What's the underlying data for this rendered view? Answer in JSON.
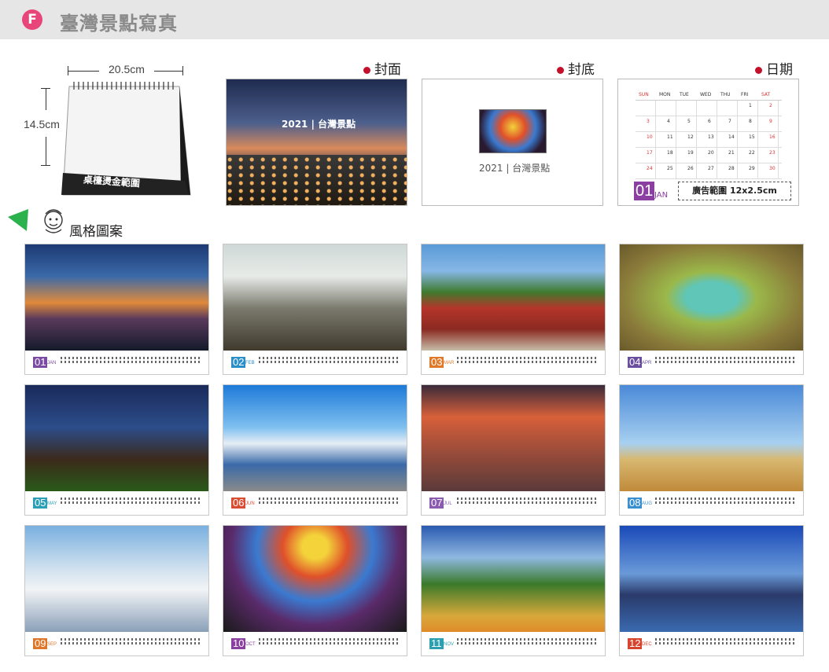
{
  "header": {
    "badge": "F",
    "title": "臺灣景點寫真"
  },
  "product": {
    "width_label": "20.5cm",
    "height_label": "14.5cm",
    "base_text": "桌檯燙金範圍"
  },
  "previews": [
    {
      "label": "封面",
      "text": "2021 | 台灣景點"
    },
    {
      "label": "封底",
      "text": "2021 | 台灣景點"
    },
    {
      "label": "日期",
      "month_num": "01",
      "month_name": "JAN",
      "ad_text": "廣告範圍 12x2.5cm"
    }
  ],
  "style_section": {
    "label": "風格圖案"
  },
  "weekdays": [
    "SUN",
    "MON",
    "TUE",
    "WED",
    "THU",
    "FRI",
    "SAT"
  ],
  "months": [
    {
      "num": "01",
      "name": "JAN",
      "color": "#7b4aa3"
    },
    {
      "num": "02",
      "name": "FEB",
      "color": "#2a8fc9"
    },
    {
      "num": "03",
      "name": "MAR",
      "color": "#e07a2a"
    },
    {
      "num": "04",
      "name": "APR",
      "color": "#6a4fa0"
    },
    {
      "num": "05",
      "name": "MAY",
      "color": "#2a9fb5"
    },
    {
      "num": "06",
      "name": "JUN",
      "color": "#d94e33"
    },
    {
      "num": "07",
      "name": "JUL",
      "color": "#8a5bb0"
    },
    {
      "num": "08",
      "name": "AUG",
      "color": "#3a8fd0"
    },
    {
      "num": "09",
      "name": "SEP",
      "color": "#e0762a"
    },
    {
      "num": "10",
      "name": "OCT",
      "color": "#8b3fa0"
    },
    {
      "num": "11",
      "name": "NOV",
      "color": "#2aa0b0"
    },
    {
      "num": "12",
      "name": "DEC",
      "color": "#d8452f"
    }
  ]
}
